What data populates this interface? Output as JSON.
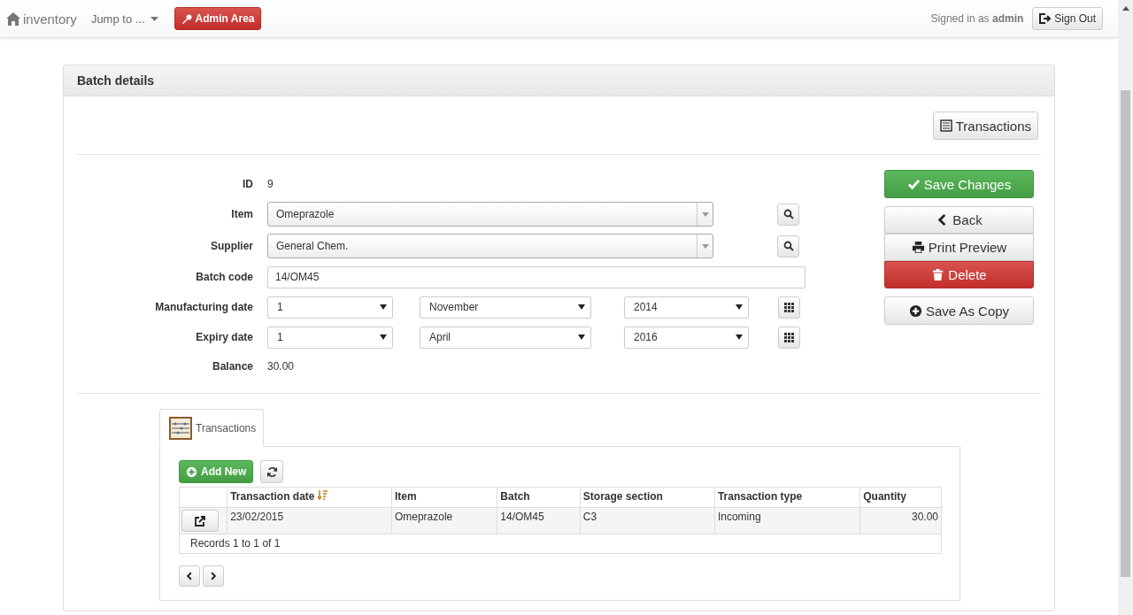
{
  "navbar": {
    "brand": "inventory",
    "jump_menu": "Jump to ...",
    "admin_button": "Admin Area",
    "signed_in": "Signed in as **admin**",
    "sign_out": "Sign Out"
  },
  "panel": {
    "title": "Batch details",
    "transactions_button": "Transactions",
    "fields": [
      {
        "label": "ID",
        "kind": "static",
        "value": "9"
      },
      {
        "label": "Item",
        "kind": "combo",
        "value": "Omeprazole"
      },
      {
        "label": "Supplier",
        "kind": "combo",
        "value": "General Chem."
      },
      {
        "label": "Batch code",
        "kind": "text",
        "value": "14/OM45"
      },
      {
        "label": "Manufacturing date",
        "kind": "date",
        "parts": [
          "1",
          "November",
          "2014"
        ]
      },
      {
        "label": "Expiry date",
        "kind": "date",
        "parts": [
          "1",
          "April",
          "2016"
        ]
      },
      {
        "label": "Balance",
        "kind": "static",
        "value": "30.00"
      }
    ],
    "actions": [
      {
        "label": "Save Changes",
        "kind": "save",
        "grouped": false
      },
      {
        "label": "Back",
        "kind": "back",
        "grouped": true
      },
      {
        "label": "Print Preview",
        "kind": "print",
        "grouped": true
      },
      {
        "label": "Delete",
        "kind": "delete",
        "grouped": true
      },
      {
        "label": "Save As Copy",
        "kind": "copy",
        "grouped": false
      }
    ],
    "tabs": [
      {
        "label": "Transactions",
        "selected": true
      }
    ],
    "add_button": "Add New",
    "table": {
      "columns": [
        {
          "label": "Transaction date",
          "sorted": true
        },
        {
          "label": "Item",
          "sorted": false
        },
        {
          "label": "Batch",
          "sorted": false
        },
        {
          "label": "Storage section",
          "sorted": false
        },
        {
          "label": "Transaction type",
          "sorted": false
        },
        {
          "label": "Quantity",
          "sorted": false
        }
      ],
      "rows": [
        {
          "cells": [
            "23/02/2015",
            "Omeprazole",
            "14/OM45",
            "C3",
            "Incoming",
            "30.00"
          ]
        }
      ],
      "footer": "Records 1 to 1 of 1"
    }
  }
}
